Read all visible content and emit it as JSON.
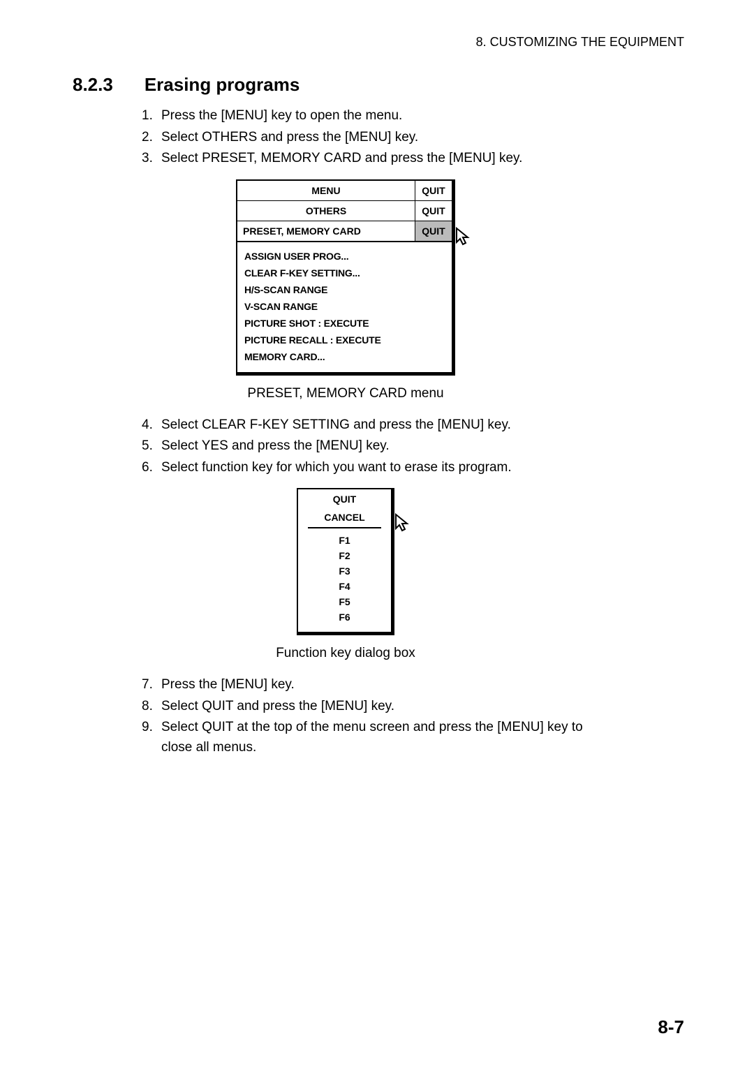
{
  "header": "8. CUSTOMIZING THE EQUIPMENT",
  "section_num": "8.2.3",
  "section_title": "Erasing programs",
  "steps": [
    {
      "num": "1.",
      "text": "Press the [MENU] key to open the menu."
    },
    {
      "num": "2.",
      "text": "Select OTHERS and press the [MENU] key."
    },
    {
      "num": "3.",
      "text": "Select PRESET, MEMORY CARD and press the [MENU] key."
    }
  ],
  "menu": {
    "row1_title": "MENU",
    "row1_quit": "QUIT",
    "row2_title": "OTHERS",
    "row2_quit": "QUIT",
    "row3_title": "PRESET, MEMORY CARD",
    "row3_quit": "QUIT",
    "items": [
      "ASSIGN USER PROG...",
      "CLEAR F-KEY SETTING...",
      "H/S-SCAN RANGE",
      "V-SCAN RANGE",
      "PICTURE SHOT      : EXECUTE",
      "PICTURE RECALL   : EXECUTE",
      "MEMORY CARD..."
    ]
  },
  "caption1": "PRESET, MEMORY CARD menu",
  "steps2": [
    {
      "num": "4.",
      "text": "Select CLEAR F-KEY SETTING and press the [MENU] key."
    },
    {
      "num": "5.",
      "text": "Select YES and press the [MENU] key."
    },
    {
      "num": "6.",
      "text": "Select function key for which you want to erase its program."
    }
  ],
  "dialog": {
    "quit": "QUIT",
    "cancel": "CANCEL",
    "items": [
      "F1",
      "F2",
      "F3",
      "F4",
      "F5",
      "F6"
    ]
  },
  "caption2": "Function key dialog box",
  "steps3": [
    {
      "num": "7.",
      "text": "Press the [MENU] key."
    },
    {
      "num": "8.",
      "text": "Select QUIT and press the [MENU] key."
    },
    {
      "num": "9.",
      "text": "Select QUIT at the top of the menu screen and press the [MENU] key to",
      "cont": "close all menus."
    }
  ],
  "page_num": "8-7"
}
